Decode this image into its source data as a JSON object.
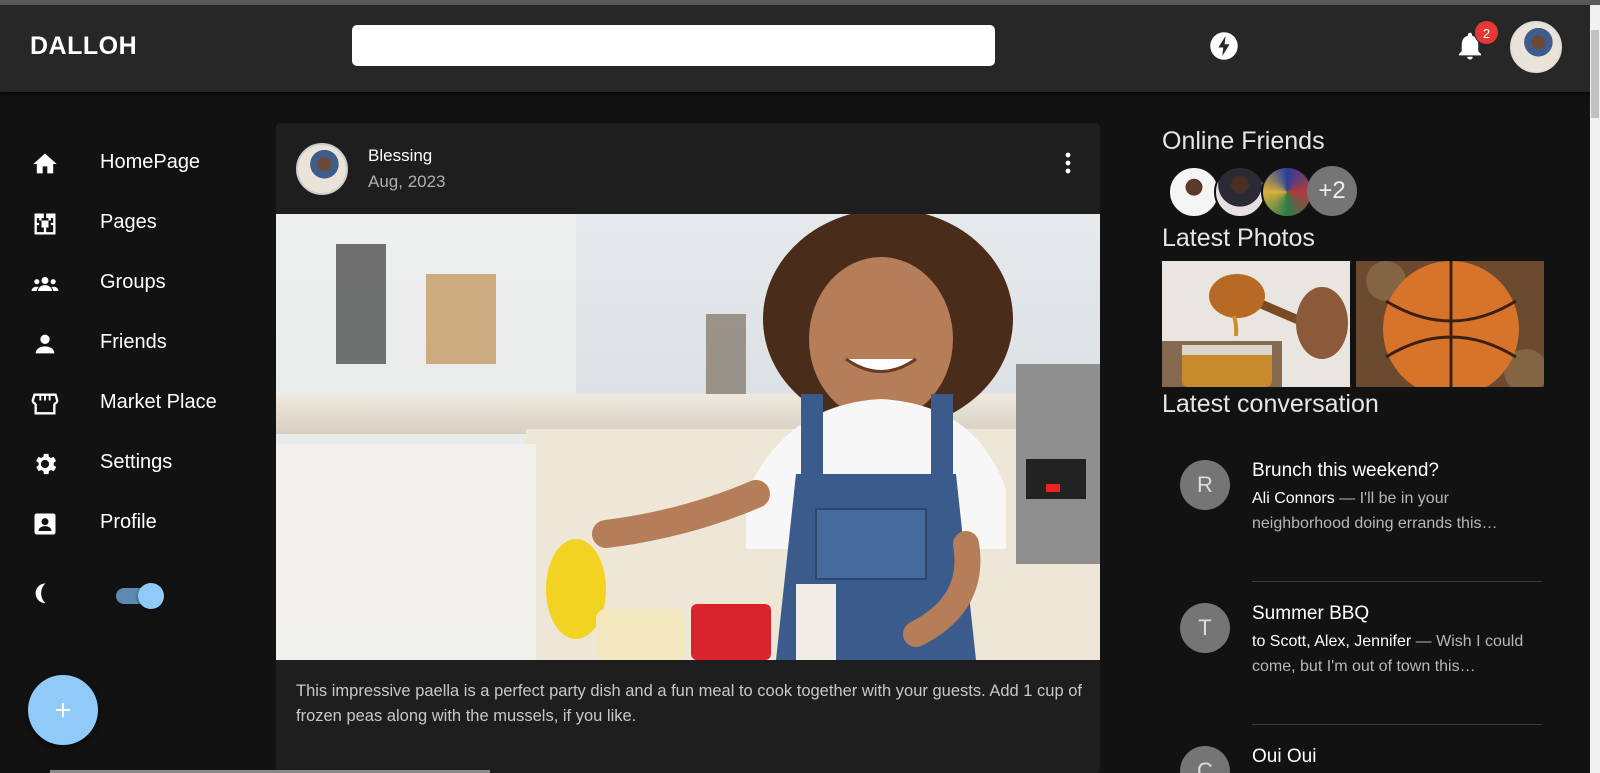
{
  "app": {
    "brand": "DALLOH"
  },
  "header": {
    "search": {
      "value": "",
      "placeholder": ""
    },
    "notification_count": "2",
    "icons": [
      "bolt-icon",
      "bell-icon"
    ]
  },
  "sidebar": {
    "items": [
      {
        "label": "HomePage",
        "icon": "home-icon"
      },
      {
        "label": "Pages",
        "icon": "pages-icon"
      },
      {
        "label": "Groups",
        "icon": "groups-icon"
      },
      {
        "label": "Friends",
        "icon": "person-icon"
      },
      {
        "label": "Market Place",
        "icon": "storefront-icon"
      },
      {
        "label": "Settings",
        "icon": "gear-icon"
      },
      {
        "label": "Profile",
        "icon": "profile-card-icon"
      }
    ],
    "dark_mode_on": true,
    "fab_icon": "plus-icon"
  },
  "post": {
    "author": "Blessing",
    "date": "Aug, 2023",
    "text": "This impressive paella is a perfect party dish and a fun meal to cook together with your guests. Add 1 cup of frozen peas along with the mussels, if you like."
  },
  "right": {
    "online_title": "Online Friends",
    "online_more": "+2",
    "photos_title": "Latest Photos",
    "conversation_title": "Latest conversation",
    "conversations": [
      {
        "initial": "R",
        "title": "Brunch this weekend?",
        "who": "Ali Connors",
        "snippet": " — I'll be in your neighborhood doing errands this…"
      },
      {
        "initial": "T",
        "title": "Summer BBQ",
        "who": "to Scott, Alex, Jennifer",
        "snippet": " — Wish I could come, but I'm out of town this…"
      },
      {
        "initial": "C",
        "title": "Oui Oui",
        "who": "",
        "snippet": ""
      }
    ]
  },
  "colors": {
    "background": "#121212",
    "appbar": "#272727",
    "card": "#1e1e1e",
    "accent": "#90caf9",
    "badge": "#e53935"
  }
}
